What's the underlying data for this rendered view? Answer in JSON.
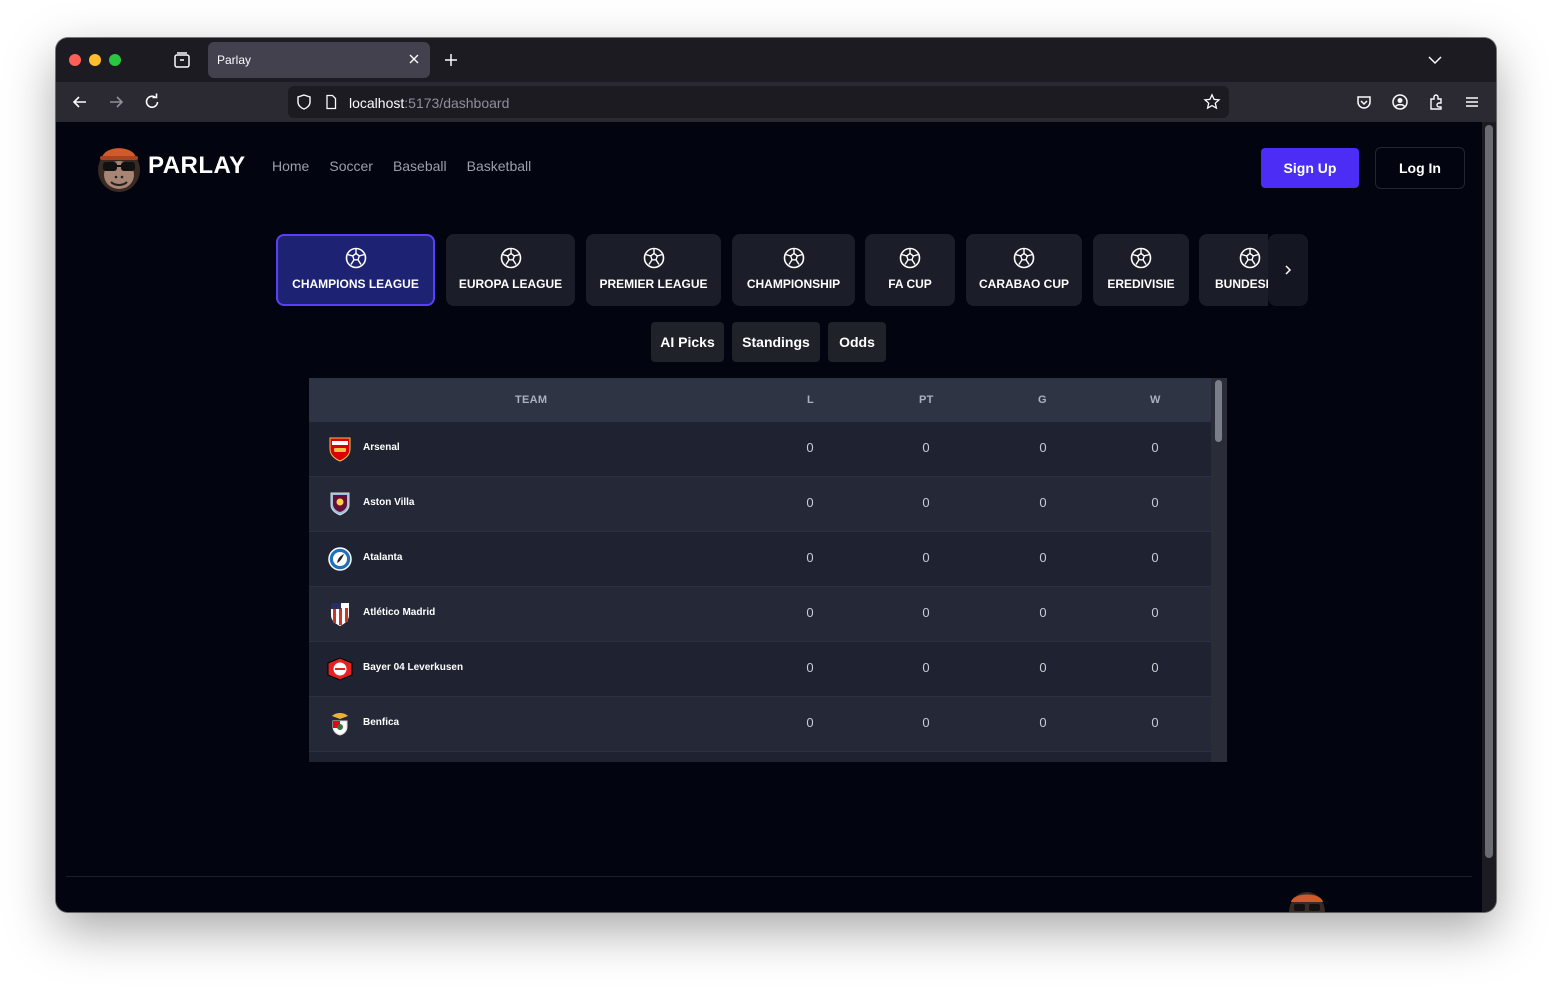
{
  "browser": {
    "tab_title": "Parlay",
    "url_host": "localhost",
    "url_path": ":5173/dashboard"
  },
  "header": {
    "brand": "PARLAY",
    "nav": [
      "Home",
      "Soccer",
      "Baseball",
      "Basketball"
    ],
    "signup_label": "Sign Up",
    "login_label": "Log In"
  },
  "leagues": [
    {
      "label": "CHAMPIONS LEAGUE",
      "active": true
    },
    {
      "label": "EUROPA LEAGUE",
      "active": false
    },
    {
      "label": "PREMIER LEAGUE",
      "active": false
    },
    {
      "label": "CHAMPIONSHIP",
      "active": false
    },
    {
      "label": "FA CUP",
      "active": false
    },
    {
      "label": "CARABAO CUP",
      "active": false
    },
    {
      "label": "EREDIVISIE",
      "active": false
    },
    {
      "label": "BUNDESLIGA",
      "active": false
    }
  ],
  "subtabs": [
    "AI Picks",
    "Standings",
    "Odds"
  ],
  "table": {
    "columns": [
      "TEAM",
      "L",
      "PT",
      "G",
      "W"
    ],
    "rows": [
      {
        "team": "Arsenal",
        "crest": "arsenal-crest-icon",
        "l": "0",
        "pt": "0",
        "g": "0",
        "w": "0"
      },
      {
        "team": "Aston Villa",
        "crest": "aston-villa-crest-icon",
        "l": "0",
        "pt": "0",
        "g": "0",
        "w": "0"
      },
      {
        "team": "Atalanta",
        "crest": "atalanta-crest-icon",
        "l": "0",
        "pt": "0",
        "g": "0",
        "w": "0"
      },
      {
        "team": "Atlético Madrid",
        "crest": "atletico-madrid-crest-icon",
        "l": "0",
        "pt": "0",
        "g": "0",
        "w": "0"
      },
      {
        "team": "Bayer 04 Leverkusen",
        "crest": "leverkusen-crest-icon",
        "l": "0",
        "pt": "0",
        "g": "0",
        "w": "0"
      },
      {
        "team": "Benfica",
        "crest": "benfica-crest-icon",
        "l": "0",
        "pt": "0",
        "g": "0",
        "w": "0"
      }
    ]
  },
  "colors": {
    "accent": "#4c2df5",
    "active_league_bg": "#1d2372",
    "page_bg": "#02040f"
  }
}
